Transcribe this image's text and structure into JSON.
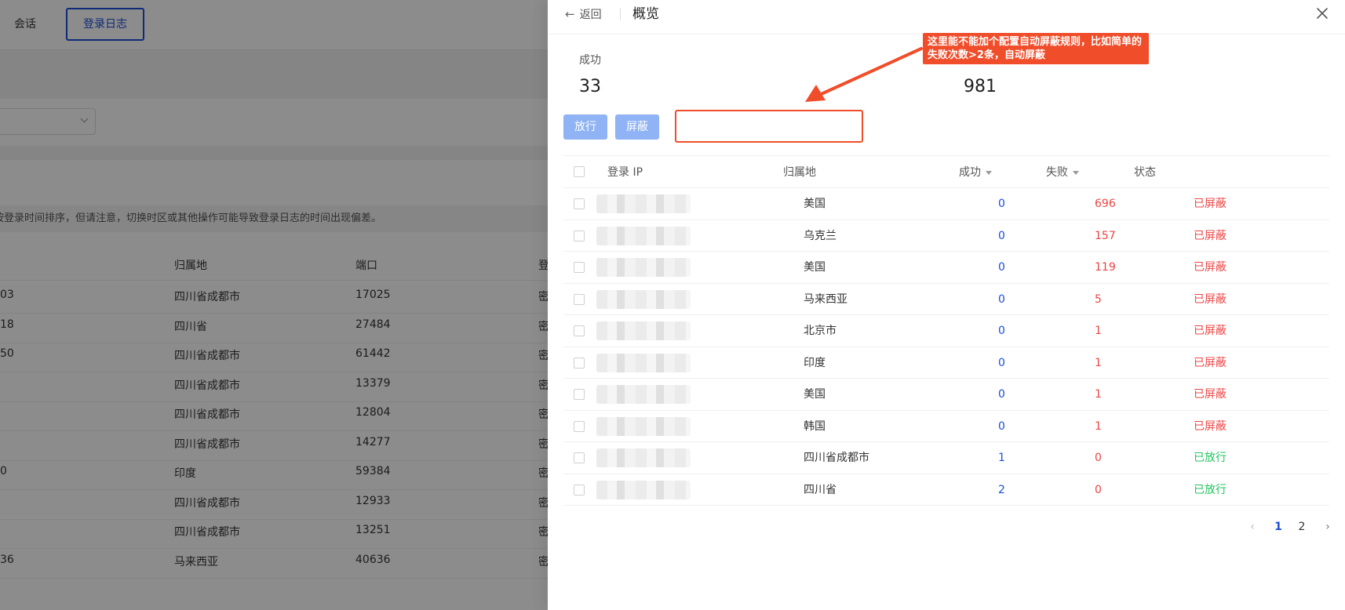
{
  "background": {
    "tabs": [
      "会话",
      "登录日志"
    ],
    "notice": "按登录时间排序，但请注意，切换时区或其他操作可能导致登录日志的时间出现偏差。",
    "columns": [
      "归属地",
      "端口",
      "登"
    ],
    "rows": [
      {
        "ip_tail": "03",
        "loc": "四川省成都市",
        "port": "17025",
        "tail": "密"
      },
      {
        "ip_tail": "18",
        "loc": "四川省",
        "port": "27484",
        "tail": "密"
      },
      {
        "ip_tail": "50",
        "loc": "四川省成都市",
        "port": "61442",
        "tail": "密"
      },
      {
        "ip_tail": "",
        "loc": "四川省成都市",
        "port": "13379",
        "tail": "密"
      },
      {
        "ip_tail": "",
        "loc": "四川省成都市",
        "port": "12804",
        "tail": "密"
      },
      {
        "ip_tail": "",
        "loc": "四川省成都市",
        "port": "14277",
        "tail": "密"
      },
      {
        "ip_tail": "0",
        "loc": "印度",
        "port": "59384",
        "tail": "密"
      },
      {
        "ip_tail": "",
        "loc": "四川省成都市",
        "port": "12933",
        "tail": "密"
      },
      {
        "ip_tail": "",
        "loc": "四川省成都市",
        "port": "13251",
        "tail": "密"
      },
      {
        "ip_tail": "36",
        "loc": "马来西亚",
        "port": "40636",
        "tail": "密"
      }
    ]
  },
  "drawer": {
    "back_label": "返回",
    "title": "概览",
    "stats": {
      "success_label": "成功",
      "success_value": "33",
      "fail_value": "981"
    },
    "buttons": {
      "allow": "放行",
      "block": "屏蔽"
    },
    "annotation": "这里能不能加个配置自动屏蔽规则，比如简单的失败次数>2条，自动屏蔽",
    "table": {
      "headers": {
        "ip": "登录 IP",
        "location": "归属地",
        "success": "成功",
        "fail": "失败",
        "status": "状态"
      },
      "rows": [
        {
          "location": "美国",
          "success": "0",
          "fail": "696",
          "status": "已屏蔽",
          "state": "blocked"
        },
        {
          "location": "乌克兰",
          "success": "0",
          "fail": "157",
          "status": "已屏蔽",
          "state": "blocked"
        },
        {
          "location": "美国",
          "success": "0",
          "fail": "119",
          "status": "已屏蔽",
          "state": "blocked"
        },
        {
          "location": "马来西亚",
          "success": "0",
          "fail": "5",
          "status": "已屏蔽",
          "state": "blocked"
        },
        {
          "location": "北京市",
          "success": "0",
          "fail": "1",
          "status": "已屏蔽",
          "state": "blocked"
        },
        {
          "location": "印度",
          "success": "0",
          "fail": "1",
          "status": "已屏蔽",
          "state": "blocked"
        },
        {
          "location": "美国",
          "success": "0",
          "fail": "1",
          "status": "已屏蔽",
          "state": "blocked"
        },
        {
          "location": "韩国",
          "success": "0",
          "fail": "1",
          "status": "已屏蔽",
          "state": "blocked"
        },
        {
          "location": "四川省成都市",
          "success": "1",
          "fail": "0",
          "status": "已放行",
          "state": "allowed"
        },
        {
          "location": "四川省",
          "success": "2",
          "fail": "0",
          "status": "已放行",
          "state": "allowed"
        }
      ]
    },
    "pagination": {
      "pages": [
        "1",
        "2"
      ],
      "current": "1"
    }
  },
  "colors": {
    "accent": "#1d4ed8",
    "danger": "#ef4444",
    "success": "#22c55e",
    "annotation": "#f04d2a",
    "button": "#8fb3f4"
  }
}
